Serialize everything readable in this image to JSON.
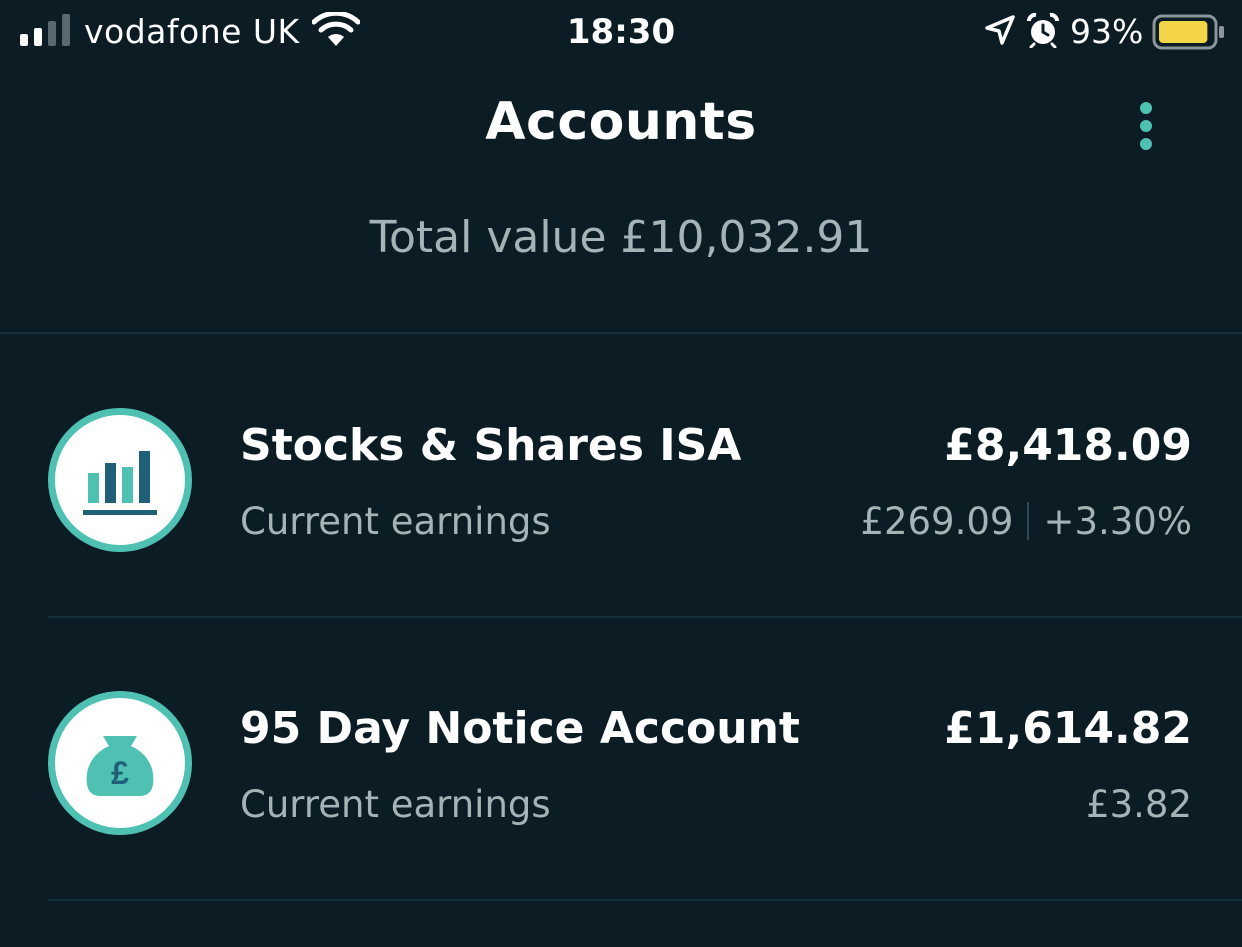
{
  "status_bar": {
    "carrier": "vodafone UK",
    "time": "18:30",
    "battery_percent": "93%",
    "battery_level": 0.93,
    "battery_color": "#f4d548",
    "signal_bars": 2,
    "icons": [
      "signal-icon",
      "wifi-icon",
      "location-arrow-icon",
      "alarm-clock-icon",
      "battery-icon"
    ]
  },
  "header": {
    "title": "Accounts",
    "more_icon": "more-vertical-icon"
  },
  "summary": {
    "total_label": "Total value £10,032.91"
  },
  "accounts": [
    {
      "name": "Stocks & Shares ISA",
      "subtitle": "Current earnings",
      "value": "£8,418.09",
      "earnings": "£269.09",
      "earnings_pct": "+3.30%",
      "icon": "bar-chart-icon"
    },
    {
      "name": "95 Day Notice Account",
      "subtitle": "Current earnings",
      "value": "£1,614.82",
      "earnings": "£3.82",
      "icon": "money-bag-icon",
      "icon_glyph": "£"
    }
  ],
  "colors": {
    "background": "#0b1c24",
    "accent": "#4fc1b2",
    "muted_text": "#a5b2b6",
    "divider": "#14303a"
  }
}
